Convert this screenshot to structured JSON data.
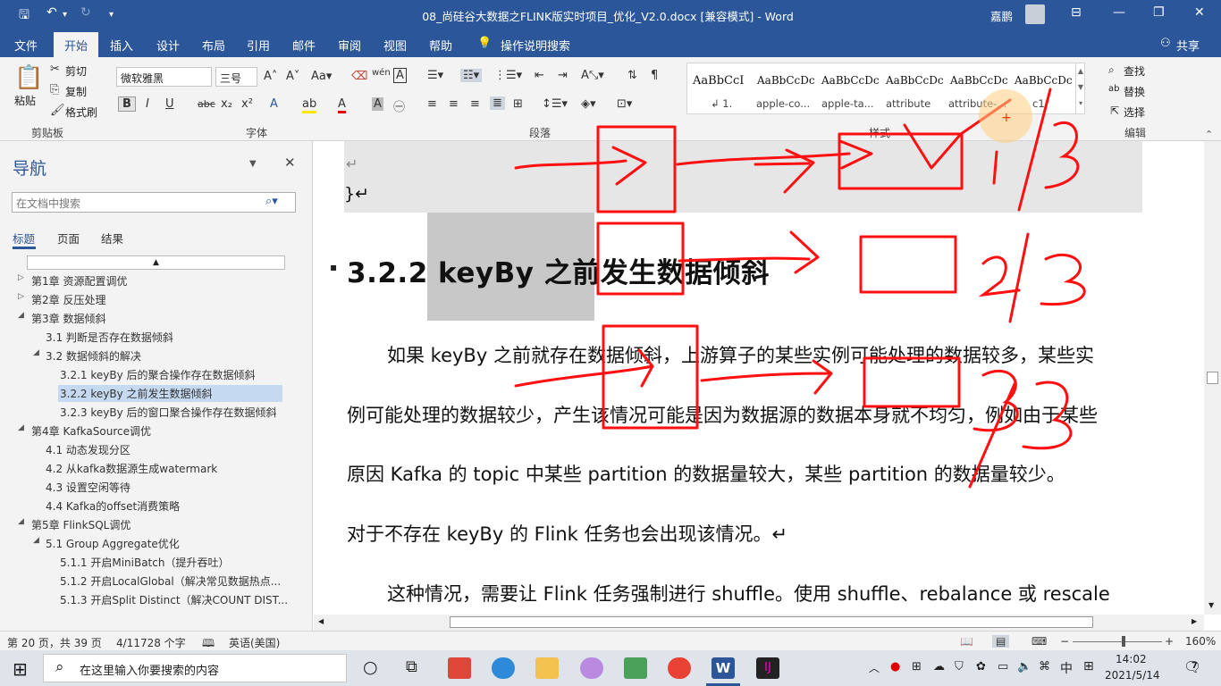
{
  "window": {
    "title": "08_尚硅谷大数据之FLINK版实时项目_优化_V2.0.docx [兼容模式]  -  Word",
    "user": "嘉鹏"
  },
  "ribbon_tabs": [
    "文件",
    "开始",
    "插入",
    "设计",
    "布局",
    "引用",
    "邮件",
    "审阅",
    "视图",
    "帮助"
  ],
  "tell_me": "操作说明搜索",
  "share": "共享",
  "clipboard": {
    "paste": "粘贴",
    "cut": "剪切",
    "copy": "复制",
    "format_painter": "格式刷",
    "group": "剪贴板"
  },
  "font": {
    "name": "微软雅黑",
    "size": "三号",
    "group": "字体"
  },
  "paragraph": {
    "group": "段落"
  },
  "styles": {
    "group": "样式",
    "items": [
      {
        "preview": "AaBbCcI",
        "name": "↲ 1."
      },
      {
        "preview": "AaBbCcDc",
        "name": "apple-co..."
      },
      {
        "preview": "AaBbCcDc",
        "name": "apple-ta..."
      },
      {
        "preview": "AaBbCcDc",
        "name": "attribute"
      },
      {
        "preview": "AaBbCcDc",
        "name": "attribute-..."
      },
      {
        "preview": "AaBbCcDc",
        "name": "c1"
      }
    ]
  },
  "editing": {
    "find": "查找",
    "replace": "替换",
    "select": "选择",
    "group": "编辑"
  },
  "nav": {
    "title": "导航",
    "search_placeholder": "在文档中搜索",
    "tabs": [
      "标题",
      "页面",
      "结果"
    ],
    "items": [
      {
        "label": "第1章 资源配置调优",
        "level": 1,
        "arrow": "▷"
      },
      {
        "label": "第2章 反压处理",
        "level": 1,
        "arrow": "▷"
      },
      {
        "label": "第3章 数据倾斜",
        "level": 1,
        "arrow": "◢"
      },
      {
        "label": "3.1 判断是否存在数据倾斜",
        "level": 2,
        "arrow": ""
      },
      {
        "label": "3.2 数据倾斜的解决",
        "level": 2,
        "arrow": "◢"
      },
      {
        "label": "3.2.1 keyBy 后的聚合操作存在数据倾斜",
        "level": 3,
        "arrow": ""
      },
      {
        "label": "3.2.2 keyBy 之前发生数据倾斜",
        "level": 3,
        "arrow": "",
        "selected": true
      },
      {
        "label": "3.2.3 keyBy 后的窗口聚合操作存在数据倾斜",
        "level": 3,
        "arrow": ""
      },
      {
        "label": "第4章 KafkaSource调优",
        "level": 1,
        "arrow": "◢"
      },
      {
        "label": "4.1 动态发现分区",
        "level": 2,
        "arrow": ""
      },
      {
        "label": "4.2 从kafka数据源生成watermark",
        "level": 2,
        "arrow": ""
      },
      {
        "label": "4.3 设置空闲等待",
        "level": 2,
        "arrow": ""
      },
      {
        "label": "4.4 Kafka的offset消费策略",
        "level": 2,
        "arrow": ""
      },
      {
        "label": "第5章 FlinkSQL调优",
        "level": 1,
        "arrow": "◢"
      },
      {
        "label": "5.1 Group Aggregate优化",
        "level": 2,
        "arrow": "◢"
      },
      {
        "label": "5.1.1 开启MiniBatch（提升吞吐）",
        "level": 3,
        "arrow": ""
      },
      {
        "label": "5.1.2 开启LocalGlobal（解决常见数据热点...",
        "level": 3,
        "arrow": ""
      },
      {
        "label": "5.1.3 开启Split Distinct（解决COUNT DIST...",
        "level": 3,
        "arrow": ""
      }
    ]
  },
  "document": {
    "code_mark": "↵",
    "code_close": "}↵",
    "heading": "3.2.2 keyBy  之前发生数据倾斜",
    "para_lines": [
      "如果  keyBy  之前就存在数据倾斜，上游算子的某些实例可能处理的数据较多，某些实",
      "例可能处理的数据较少，产生该情况可能是因为数据源的数据本身就不均匀，例如由于某些",
      "原因  Kafka  的  topic  中某些  partition  的数据量较大，某些  partition  的数据量较少。",
      "对于不存在  keyBy  的  Flink  任务也会出现该情况。↵",
      "这种情况，需要让  Flink  任务强制进行 shuffle。使用 shuffle、rebalance  或  rescale"
    ]
  },
  "ink_labels": [
    "1/3",
    "2/3",
    "3/3"
  ],
  "status": {
    "page": "第 20 页，共 39 页",
    "words": "4/11728 个字",
    "lang": "英语(美国)",
    "zoom": "160%"
  },
  "taskbar": {
    "search": "在这里输入你要搜索的内容",
    "time": "14:02",
    "date": "2021/5/14",
    "ime": "中",
    "notif": "7"
  },
  "colors": {
    "word_blue": "#2b579a",
    "ink_red": "#ff0000"
  }
}
